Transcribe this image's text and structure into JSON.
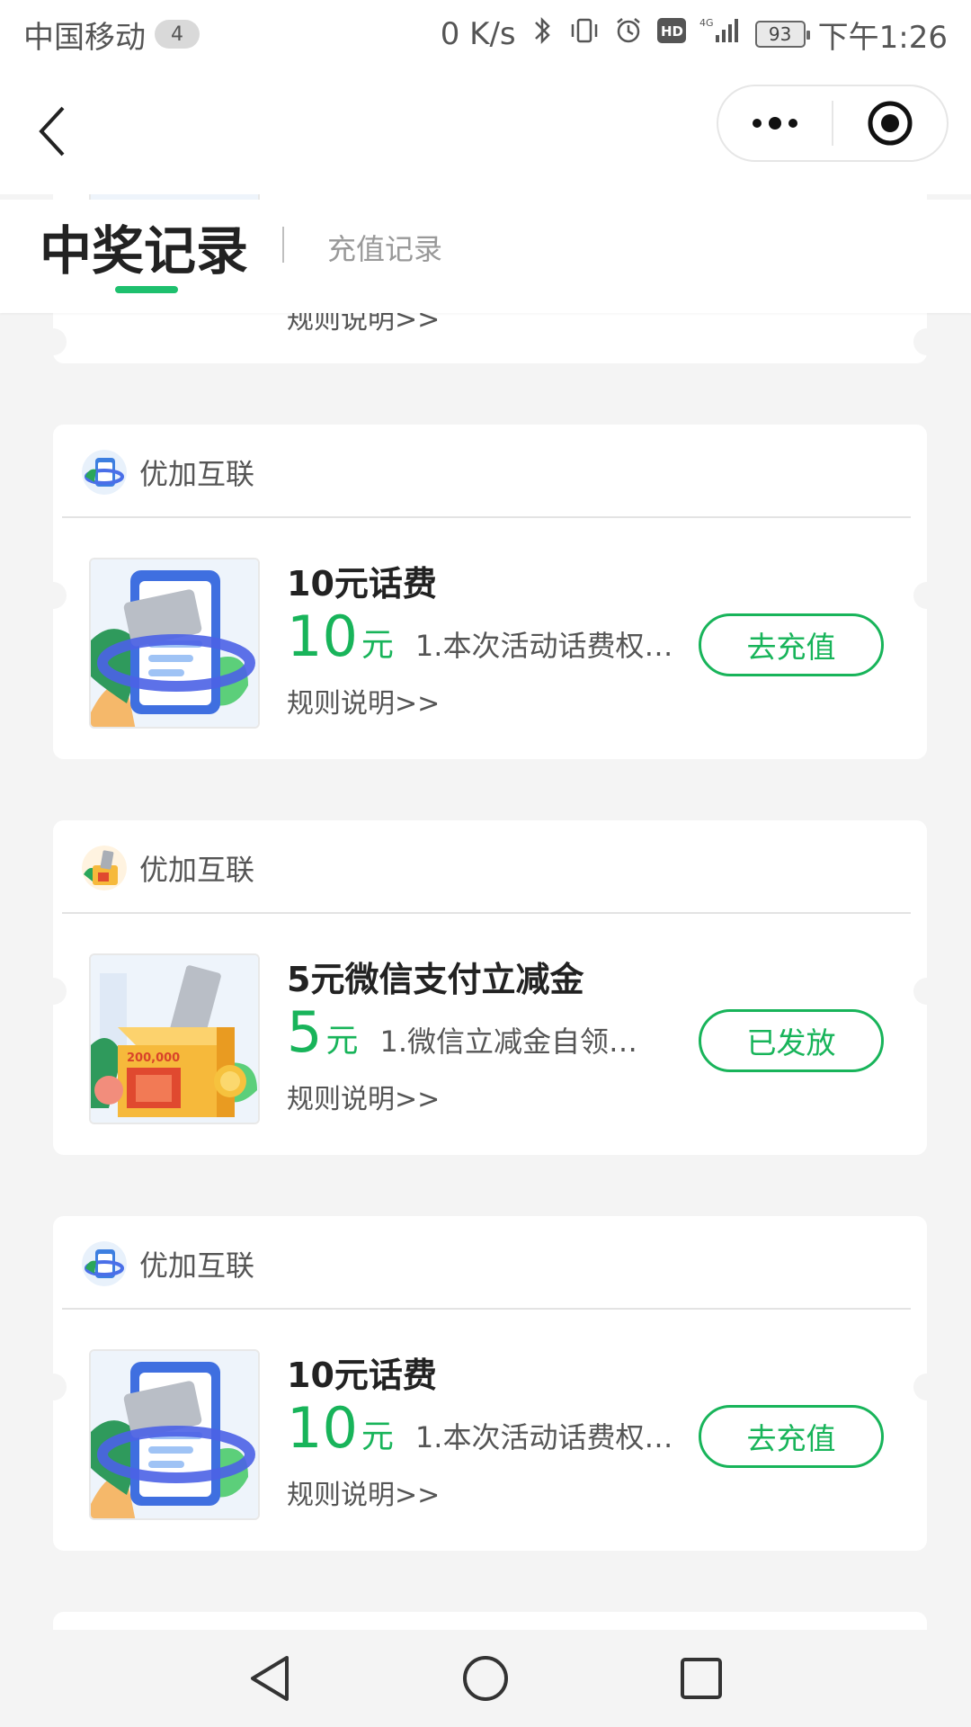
{
  "status_bar": {
    "carrier": "中国移动",
    "carrier_badge": "4",
    "speed": "0 K/s",
    "battery": "93",
    "time": "下午1:26"
  },
  "tabs": {
    "active": "中奖记录",
    "inactive": "充值记录"
  },
  "cards": [
    {
      "brand": "优加互联",
      "title": "10元话费",
      "amount": "10",
      "unit": "元",
      "desc": "1.本次活动话费权…",
      "rules": "规则说明>>",
      "button": "去充值",
      "image": "phone-card"
    },
    {
      "brand": "优加互联",
      "title": "5元微信支付立减金",
      "amount": "5",
      "unit": "元",
      "desc": "1.微信立减金自领…",
      "rules": "规则说明>>",
      "button": "已发放",
      "image": "gift-box"
    },
    {
      "brand": "优加互联",
      "title": "10元话费",
      "amount": "10",
      "unit": "元",
      "desc": "1.本次活动话费权…",
      "rules": "规则说明>>",
      "button": "去充值",
      "image": "phone-card"
    }
  ],
  "partial_card": {
    "rules": "规则说明>>"
  },
  "colors": {
    "accent": "#18b45a",
    "tab_underline": "#1ec06e",
    "page_background": "#f4f4f4"
  }
}
